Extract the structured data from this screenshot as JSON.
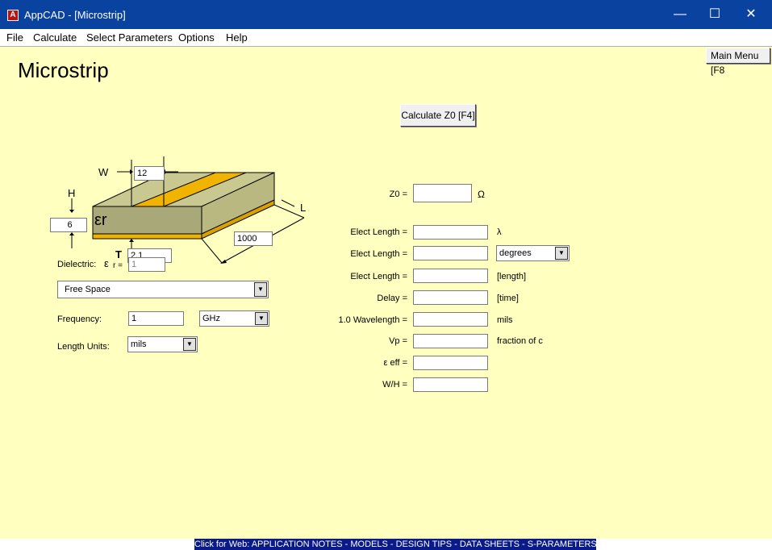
{
  "window": {
    "title": "AppCAD - [Microstrip]",
    "app_icon_letter": "A"
  },
  "window_controls": {
    "minimize": "—",
    "maximize": "☐",
    "close": "✕"
  },
  "menu": [
    "File",
    "Calculate",
    "Select Parameters",
    "Options",
    "Help"
  ],
  "page": {
    "title": "Microstrip",
    "main_menu_label": "Main Menu [F8",
    "calculate_label": "Calculate Z0  [F4]"
  },
  "diagram": {
    "w_label": "W",
    "w_value": "12",
    "h_label": "H",
    "h_value": "6",
    "t_label": "T",
    "t_value": "2.1",
    "l_label": "L",
    "l_value": "1000",
    "er_symbol": "εr",
    "colors": {
      "substrate_top": "#c8c890",
      "substrate_front": "#a8a878",
      "conductor": "#f0b400"
    }
  },
  "inputs": {
    "dielectric_label": "Dielectric:",
    "er_symbol": "ε",
    "er_subscript": "r =",
    "er_value": "1",
    "material": "Free Space",
    "frequency_label": "Frequency:",
    "frequency_value": "1",
    "frequency_unit": "GHz",
    "length_units_label": "Length Units:",
    "length_units_value": "mils"
  },
  "outputs": [
    {
      "label": "Z0 =",
      "value": "",
      "unit": "Ω"
    },
    {
      "label": "Elect Length =",
      "value": "",
      "unit": "λ"
    },
    {
      "label": "Elect Length =",
      "value": "",
      "unit": "degrees"
    },
    {
      "label": "Elect Length =",
      "value": "",
      "unit": "[length]"
    },
    {
      "label": "Delay =",
      "value": "",
      "unit": "[time]"
    },
    {
      "label": "1.0 Wavelength =",
      "value": "",
      "unit": "mils"
    },
    {
      "label": "Vp =",
      "value": "",
      "unit": "fraction of c"
    },
    {
      "label": "ε eff =",
      "value": "",
      "unit": ""
    },
    {
      "label": "W/H =",
      "value": "",
      "unit": ""
    }
  ],
  "footer": {
    "link_text": "Click for Web: APPLICATION NOTES - MODELS - DESIGN TIPS - DATA SHEETS - S-PARAMETERS"
  }
}
